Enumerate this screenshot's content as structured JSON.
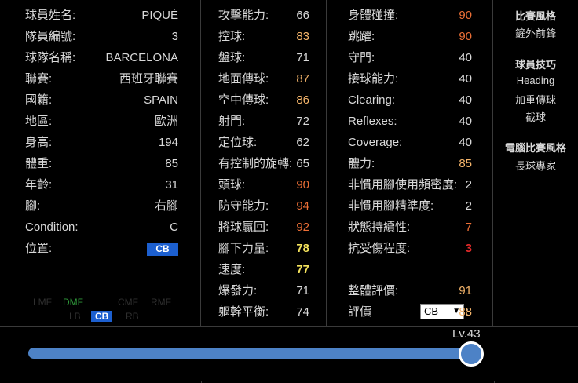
{
  "profile": [
    {
      "label": "球員姓名:",
      "value": "PIQUÉ"
    },
    {
      "label": "隊員編號:",
      "value": "3"
    },
    {
      "label": "球隊名稱:",
      "value": "BARCELONA"
    },
    {
      "label": "聯賽:",
      "value": "西班牙聯賽"
    },
    {
      "label": "國籍:",
      "value": "SPAIN"
    },
    {
      "label": "地區:",
      "value": "歐洲"
    },
    {
      "label": "身高:",
      "value": "194"
    },
    {
      "label": "體重:",
      "value": "85"
    },
    {
      "label": "年齡:",
      "value": "31"
    },
    {
      "label": "腳:",
      "value": "右腳"
    },
    {
      "label": "Condition:",
      "value": "C"
    },
    {
      "label": "位置:",
      "value": "CB"
    }
  ],
  "position_map": {
    "left_dim": "LMF",
    "dmf": "DMF",
    "right_dim_1": "CMF",
    "right_dim_2": "RMF",
    "lb_dim": "LB",
    "cb": "CB",
    "rb_dim": "RB"
  },
  "stats_mid": [
    {
      "label": "攻擊能力:",
      "value": "66"
    },
    {
      "label": "控球:",
      "value": "83"
    },
    {
      "label": "盤球:",
      "value": "71"
    },
    {
      "label": "地面傳球:",
      "value": "87"
    },
    {
      "label": "空中傳球:",
      "value": "86"
    },
    {
      "label": "射門:",
      "value": "72"
    },
    {
      "label": "定位球:",
      "value": "62"
    },
    {
      "label": "有控制的旋轉:",
      "value": "65"
    },
    {
      "label": "頭球:",
      "value": "90"
    },
    {
      "label": "防守能力:",
      "value": "94"
    },
    {
      "label": "將球贏回:",
      "value": "92"
    },
    {
      "label": "腳下力量:",
      "value": "78"
    },
    {
      "label": "速度:",
      "value": "77"
    },
    {
      "label": "爆發力:",
      "value": "71"
    },
    {
      "label": "軀幹平衡:",
      "value": "74"
    }
  ],
  "stats_right": [
    {
      "label": "身體碰撞:",
      "value": "90"
    },
    {
      "label": "跳躍:",
      "value": "90"
    },
    {
      "label": "守門:",
      "value": "40"
    },
    {
      "label": "接球能力:",
      "value": "40"
    },
    {
      "label": "Clearing:",
      "value": "40"
    },
    {
      "label": "Reflexes:",
      "value": "40"
    },
    {
      "label": "Coverage:",
      "value": "40"
    },
    {
      "label": "體力:",
      "value": "85"
    },
    {
      "label": "非慣用腳使用頻密度:",
      "value": "2"
    },
    {
      "label": "非慣用腳精準度:",
      "value": "2"
    },
    {
      "label": "狀態持續性:",
      "value": "7"
    },
    {
      "label": "抗受傷程度:",
      "value": "3"
    }
  ],
  "overall": {
    "label": "整體評價:",
    "value": "91"
  },
  "rating": {
    "label": "評價",
    "select_value": "CB",
    "colon": ":",
    "value": "88"
  },
  "styles": {
    "play_style_heading": "比賽風格",
    "play_style": "鏟外前鋒",
    "skills_heading": "球員技巧",
    "skills": [
      "Heading",
      "加重傳球",
      "截球"
    ],
    "com_style_heading": "電腦比賽風格",
    "com_style": "長球專家"
  },
  "level": {
    "label": "Lv.43",
    "current": 43,
    "max": 43
  },
  "colors": {
    "white": "#d9d9d9",
    "yellow": "#f5e35c",
    "orange": "#f4b46a",
    "dark_orange": "#ec6f36",
    "red": "#e02929",
    "accent": "#4d82c6",
    "badge": "#1c5fcf"
  }
}
